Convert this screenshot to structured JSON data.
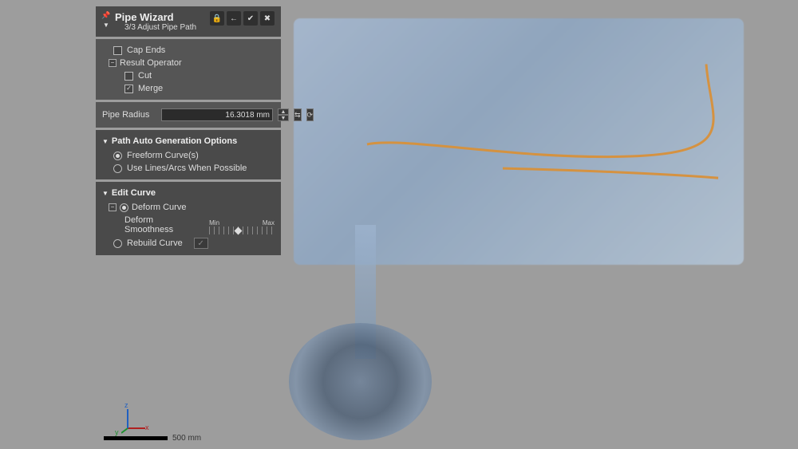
{
  "wizard": {
    "title": "Pipe Wizard",
    "subtitle": "3/3 Adjust Pipe Path",
    "header_buttons": {
      "lock": "🔒",
      "back": "←",
      "apply": "✔",
      "close": "✖"
    }
  },
  "options": {
    "cap_ends": {
      "label": "Cap Ends",
      "checked": false
    },
    "result_operator": {
      "label": "Result Operator"
    },
    "cut": {
      "label": "Cut",
      "checked": false
    },
    "merge": {
      "label": "Merge",
      "checked": true
    }
  },
  "radius": {
    "label": "Pipe Radius",
    "value": "16.3018 mm"
  },
  "path_auto": {
    "title": "Path Auto Generation Options",
    "freeform": {
      "label": "Freeform Curve(s)",
      "selected": true
    },
    "lines_arcs": {
      "label": "Use Lines/Arcs When Possible",
      "selected": false
    }
  },
  "edit_curve": {
    "title": "Edit Curve",
    "deform": {
      "label": "Deform Curve",
      "selected": true
    },
    "smoothness_label": "Deform Smoothness",
    "slider_min": "Min",
    "slider_max": "Max",
    "rebuild": {
      "label": "Rebuild Curve",
      "selected": false
    }
  },
  "viewport": {
    "axes": {
      "x": "x",
      "y": "y",
      "z": "z"
    },
    "scale_label": "500 mm"
  }
}
